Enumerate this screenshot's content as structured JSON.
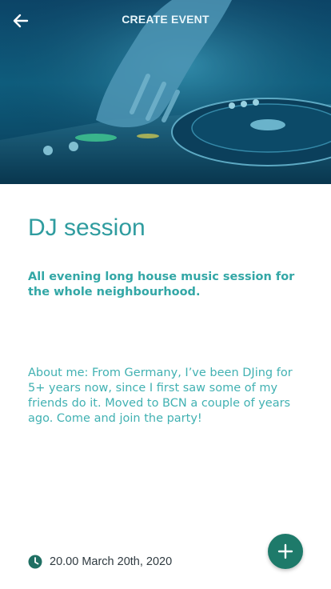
{
  "header": {
    "title": "CREATE EVENT",
    "back_icon": "arrow-left-icon"
  },
  "hero": {
    "image": "dj-turntable-photo",
    "tint": "#0f5a7a"
  },
  "event": {
    "title": "DJ session",
    "subtitle": "All evening long house music session for the whole neighbourhood.",
    "description": "About me: From Germany, I’ve been DJing for 5+ years now, since I first saw some of my friends do it. Moved to BCN a couple of years ago. Come and join the party!",
    "time_icon": "clock-icon",
    "time": "20.00 March 20th, 2020"
  },
  "fab": {
    "icon": "plus-icon",
    "color": "#1e7a6a"
  },
  "colors": {
    "accent": "#2f9c9f",
    "text_dark": "#2f3a40"
  }
}
